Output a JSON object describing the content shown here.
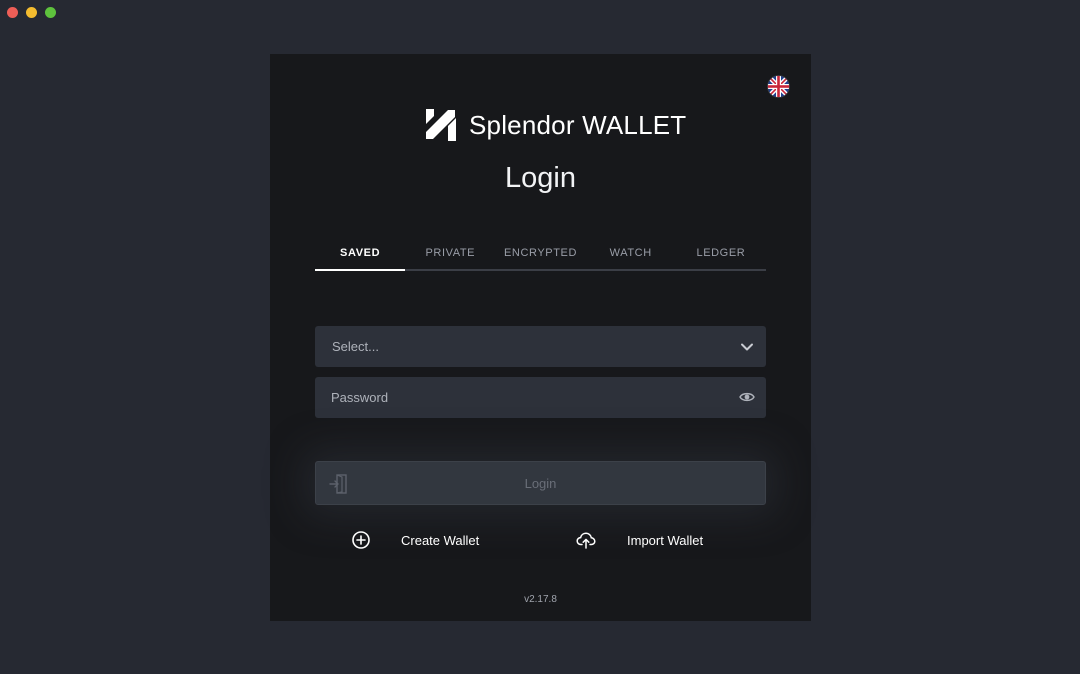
{
  "window": {
    "controls": [
      "close",
      "minimize",
      "maximize"
    ]
  },
  "header": {
    "brand_name": "Splendor WALLET",
    "logo_icon": "splendor-logo-icon",
    "language_icon": "uk-flag-icon"
  },
  "login": {
    "title": "Login",
    "tabs": [
      {
        "label": "SAVED",
        "active": true
      },
      {
        "label": "PRIVATE",
        "active": false
      },
      {
        "label": "ENCRYPTED",
        "active": false
      },
      {
        "label": "WATCH",
        "active": false
      },
      {
        "label": "LEDGER",
        "active": false
      }
    ],
    "wallet_select": {
      "value": "Select...",
      "icon": "chevron-down-icon"
    },
    "password": {
      "placeholder": "Password",
      "icon": "eye-icon"
    },
    "login_button": {
      "label": "Login",
      "icon": "door-enter-icon"
    }
  },
  "actions": {
    "create": {
      "label": "Create Wallet",
      "icon": "plus-circle-icon"
    },
    "import": {
      "label": "Import Wallet",
      "icon": "cloud-upload-icon"
    }
  },
  "footer": {
    "version": "v2.17.8"
  },
  "colors": {
    "background": "#262932",
    "panel": "#17181b",
    "field": "#2d313a",
    "text_primary": "#ffffff",
    "text_muted": "#9a9ea8"
  }
}
